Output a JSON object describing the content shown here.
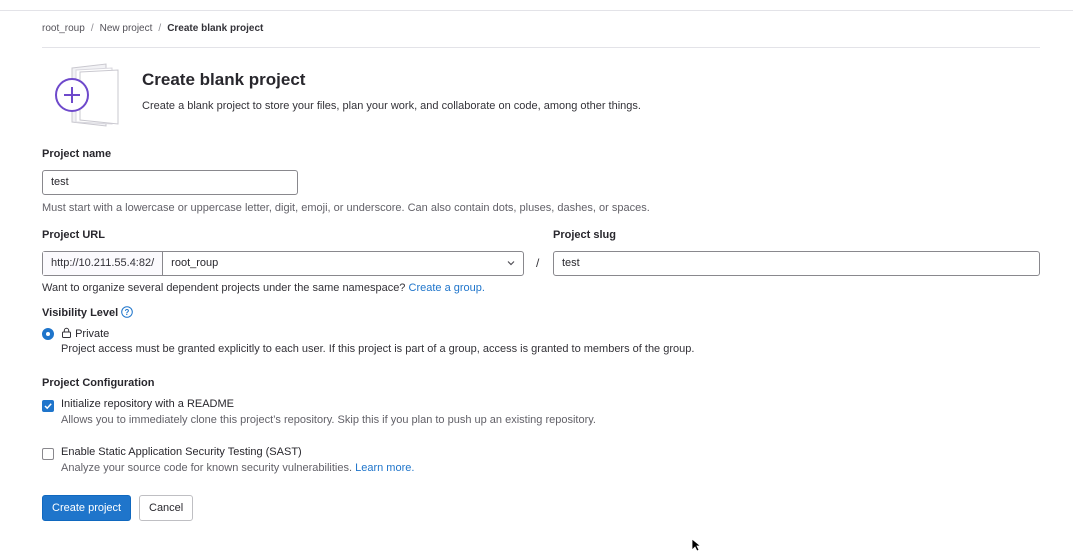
{
  "breadcrumb": [
    "root_roup",
    "New project",
    "Create blank project"
  ],
  "header": {
    "title": "Create blank project",
    "description": "Create a blank project to store your files, plan your work, and collaborate on code, among other things."
  },
  "form": {
    "project_name": {
      "label": "Project name",
      "value": "test",
      "help": "Must start with a lowercase or uppercase letter, digit, emoji, or underscore. Can also contain dots, pluses, dashes, or spaces."
    },
    "project_url": {
      "label": "Project URL",
      "prefix": "http://10.211.55.4:82/",
      "namespace": "root_roup",
      "separator": "/",
      "help_text": "Want to organize several dependent projects under the same namespace?",
      "help_link": "Create a group."
    },
    "project_slug": {
      "label": "Project slug",
      "value": "test"
    },
    "visibility": {
      "label": "Visibility Level",
      "options": [
        {
          "label": "Private",
          "description": "Project access must be granted explicitly to each user. If this project is part of a group, access is granted to members of the group.",
          "selected": true
        }
      ]
    },
    "configuration": {
      "label": "Project Configuration",
      "options": [
        {
          "label": "Initialize repository with a README",
          "description": "Allows you to immediately clone this project’s repository. Skip this if you plan to push up an existing repository.",
          "checked": true
        },
        {
          "label": "Enable Static Application Security Testing (SAST)",
          "description": "Analyze your source code for known security vulnerabilities.",
          "link": "Learn more.",
          "checked": false
        }
      ]
    }
  },
  "actions": {
    "create": "Create project",
    "cancel": "Cancel"
  },
  "colors": {
    "primary": "#1f75cb",
    "illustration": "#6e49cb"
  }
}
